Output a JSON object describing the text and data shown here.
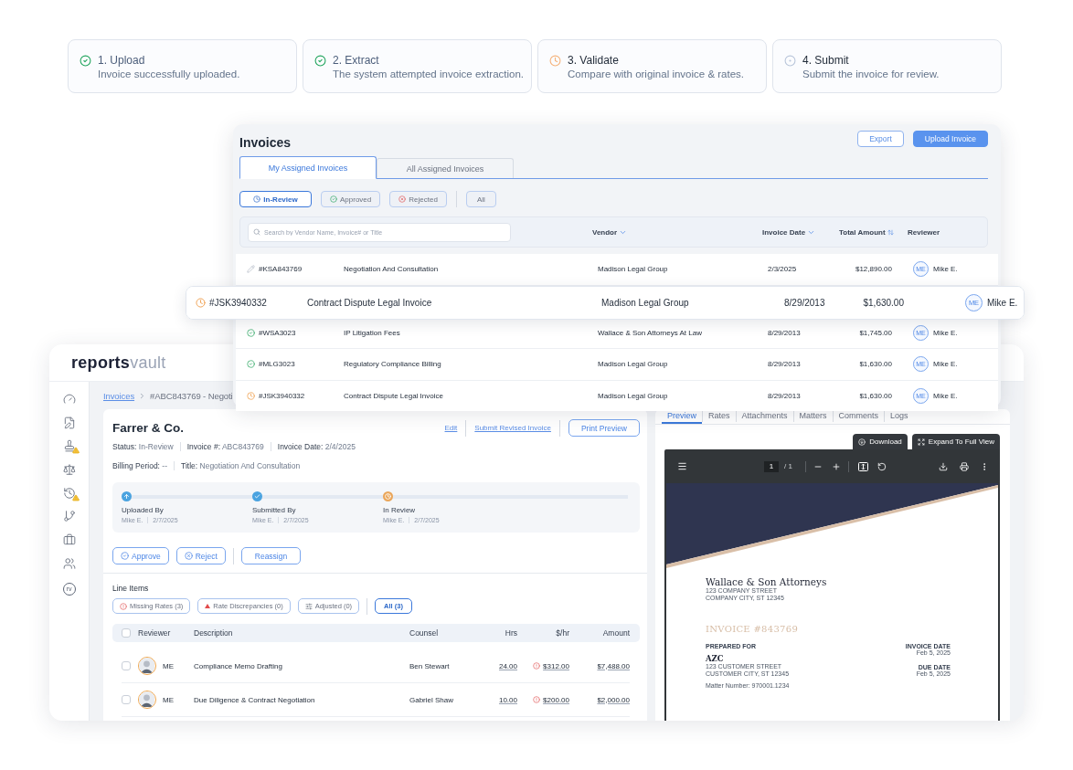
{
  "steps": [
    {
      "title": "1. Upload",
      "description": "Invoice successfully uploaded.",
      "kind": "done"
    },
    {
      "title": "2. Extract",
      "description": "The system attempted invoice extraction.",
      "kind": "done"
    },
    {
      "title": "3. Validate",
      "description": "Compare with original invoice & rates.",
      "kind": "current"
    },
    {
      "title": "4. Submit",
      "description": "Submit the invoice for review.",
      "kind": "pending"
    }
  ],
  "invoices_panel": {
    "title": "Invoices",
    "buttons": [
      {
        "label": "Export",
        "kind": "outline"
      },
      {
        "label": "Upload Invoice",
        "kind": "primary"
      }
    ],
    "tabs": [
      {
        "label": "My Assigned Invoices",
        "selected": true
      },
      {
        "label": "All Assigned Invoices",
        "selected": false
      }
    ],
    "filters": [
      {
        "label": "In-Review",
        "kind": "review",
        "selected": true
      },
      {
        "label": "Approved",
        "kind": "approved",
        "selected": false
      },
      {
        "label": "Rejected",
        "kind": "rejected",
        "selected": false
      },
      {
        "label": "All",
        "kind": "all",
        "selected": false
      }
    ],
    "search": {
      "placeholder": "Search by Vendor Name, Invoice# or Title"
    },
    "columns": [
      {
        "label": "Vendor",
        "kind": "down"
      },
      {
        "label": "Invoice Date",
        "kind": "down"
      },
      {
        "label": "Total Amount",
        "kind": "both"
      },
      {
        "label": "Reviewer",
        "kind": "none"
      }
    ],
    "rows": [
      {
        "kind": "draft",
        "id": "#KSA843769",
        "title": "Negotiation And Consultation",
        "vendor": "Madison Legal Group",
        "date": "2/3/2025",
        "amount": "$12,890.00",
        "initials": "ME",
        "reviewer": "Mike E.",
        "highlighted": false
      },
      {
        "kind": "review",
        "id": "#JSK3940332",
        "title": "Contract Dispute Legal Invoice",
        "vendor": "Madison Legal Group",
        "date": "8/29/2013",
        "amount": "$1,630.00",
        "initials": "ME",
        "reviewer": "Mike E.",
        "highlighted": true
      },
      {
        "kind": "approved",
        "id": "#WSA3023",
        "title": "IP Litigation Fees",
        "vendor": "Wallace & Son Attorneys At Law",
        "date": "8/29/2013",
        "amount": "$1,745.00",
        "initials": "ME",
        "reviewer": "Mike E.",
        "highlighted": false
      },
      {
        "kind": "approved",
        "id": "#MLG3023",
        "title": "Regulatory Compliance Billing",
        "vendor": "Madison Legal Group",
        "date": "8/29/2013",
        "amount": "$1,630.00",
        "initials": "ME",
        "reviewer": "Mike E.",
        "highlighted": false
      },
      {
        "kind": "review",
        "id": "#JSK3940332",
        "title": "Contract Dispute Legal Invoice",
        "vendor": "Madison Legal Group",
        "date": "8/29/2013",
        "amount": "$1,630.00",
        "initials": "ME",
        "reviewer": "Mike E.",
        "highlighted": false
      }
    ]
  },
  "app": {
    "logo": {
      "first": "reports",
      "second": "vault"
    },
    "sidebar": {
      "items": [
        {
          "warning": false
        },
        {
          "warning": false
        },
        {
          "warning": true
        },
        {
          "warning": false
        },
        {
          "warning": true
        },
        {
          "warning": false
        },
        {
          "warning": false
        },
        {
          "warning": false
        },
        {
          "warning": false,
          "label": "rv"
        }
      ]
    },
    "breadcrumb": [
      {
        "label": "Invoices",
        "link": true
      },
      {
        "label": "#ABC843769 - Negoti",
        "link": false
      }
    ],
    "invoice": {
      "vendor": "Farrer & Co.",
      "actions": [
        {
          "label": "Edit",
          "kind": "link"
        },
        {
          "label": "Submit Revised Invoice",
          "kind": "link"
        },
        {
          "label": "Print Preview",
          "kind": "button"
        }
      ],
      "meta": [
        [
          {
            "label": "Status:",
            "value": "In-Review"
          },
          {
            "label": "Invoice #:",
            "value": "ABC843769"
          },
          {
            "label": "Invoice Date:",
            "value": "2/4/2025"
          }
        ],
        [
          {
            "label": "Billing Period:",
            "value": "--"
          },
          {
            "label": "Title:",
            "value": "Negotiation And Consultation"
          }
        ]
      ],
      "timeline": [
        {
          "label": "Uploaded By",
          "person": "Mike E.",
          "date": "2/7/2025",
          "kind": "uploaded"
        },
        {
          "label": "Submitted By",
          "person": "Mike E.",
          "date": "2/7/2025",
          "kind": "done"
        },
        {
          "label": "In Review",
          "person": "Mike E.",
          "date": "2/7/2025",
          "kind": "review"
        }
      ],
      "decisions": [
        {
          "label": "Approve",
          "kind": "approve"
        },
        {
          "label": "Reject",
          "kind": "reject"
        },
        {
          "label": "Reassign",
          "kind": "plain"
        }
      ],
      "line_items": {
        "title": "Line Items",
        "filters": [
          {
            "label": "Missing Rates (3)",
            "kind": "missing",
            "selected": false
          },
          {
            "label": "Rate Discrepancies (0)",
            "kind": "discrepancy",
            "selected": false
          },
          {
            "label": "Adjusted (0)",
            "kind": "adjusted",
            "selected": false
          },
          {
            "label": "All (3)",
            "kind": "all",
            "selected": true
          }
        ],
        "all_checked": false,
        "columns": [
          "Reviewer",
          "Description",
          "Counsel",
          "Hrs",
          "$/hr",
          "Amount"
        ],
        "rows": [
          {
            "checked": false,
            "reviewer": "ME",
            "description": "Compliance Memo Drafting",
            "counsel": "Ben Stewart",
            "hours": "24.00",
            "rate": "$312.00",
            "rate_warning": true,
            "amount": "$7,488.00"
          },
          {
            "checked": false,
            "reviewer": "ME",
            "description": "Due Diligence & Contract Negotiation",
            "counsel": "Gabriel Shaw",
            "hours": "10.00",
            "rate": "$200.00",
            "rate_warning": true,
            "amount": "$2,000.00"
          }
        ]
      }
    },
    "preview": {
      "tabs": [
        {
          "label": "Preview",
          "selected": true
        },
        {
          "label": "Rates",
          "selected": false
        },
        {
          "label": "Attachments",
          "selected": false
        },
        {
          "label": "Matters",
          "selected": false
        },
        {
          "label": "Comments",
          "selected": false
        },
        {
          "label": "Logs",
          "selected": false
        }
      ],
      "actions": [
        {
          "label": "Download",
          "kind": "download"
        },
        {
          "label": "Expand To Full View",
          "kind": "expand"
        }
      ],
      "viewer": {
        "page": "1",
        "page_count": "/ 1"
      },
      "document": {
        "firm": "Wallace & Son Attorneys",
        "firm_address": [
          "123 COMPANY STREET",
          "COMPANY CITY, ST 12345"
        ],
        "invoice_title": "INVOICE #843769",
        "prepared_for_label": "PREPARED FOR",
        "client": "AZC",
        "client_address": [
          "123 CUSTOMER STREET",
          "CUSTOMER CITY, ST 12345"
        ],
        "dates": [
          {
            "label": "INVOICE DATE",
            "value": "Feb 5, 2025"
          },
          {
            "label": "DUE DATE",
            "value": "Feb 5, 2025"
          }
        ],
        "matter": "Matter Number: 970001.1234"
      }
    }
  }
}
